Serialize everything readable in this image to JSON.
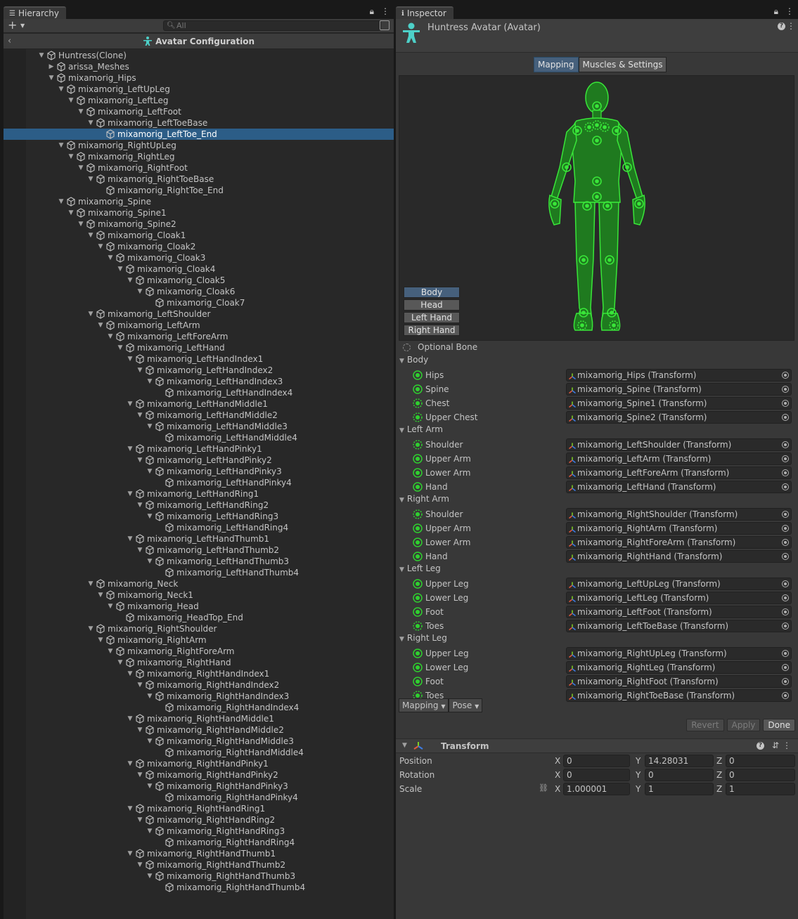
{
  "hierarchy": {
    "tab_label": "Hierarchy",
    "search_placeholder": "All",
    "header_title": "Avatar Configuration",
    "selected_row": 7,
    "rows": [
      {
        "depth": 0,
        "label": "Huntress(Clone)",
        "fold": "open"
      },
      {
        "depth": 1,
        "label": "arissa_Meshes",
        "fold": "closed"
      },
      {
        "depth": 1,
        "label": "mixamorig_Hips",
        "fold": "open"
      },
      {
        "depth": 2,
        "label": "mixamorig_LeftUpLeg",
        "fold": "open"
      },
      {
        "depth": 3,
        "label": "mixamorig_LeftLeg",
        "fold": "open"
      },
      {
        "depth": 4,
        "label": "mixamorig_LeftFoot",
        "fold": "open"
      },
      {
        "depth": 5,
        "label": "mixamorig_LeftToeBase",
        "fold": "open"
      },
      {
        "depth": 6,
        "label": "mixamorig_LeftToe_End",
        "fold": "none"
      },
      {
        "depth": 2,
        "label": "mixamorig_RightUpLeg",
        "fold": "open"
      },
      {
        "depth": 3,
        "label": "mixamorig_RightLeg",
        "fold": "open"
      },
      {
        "depth": 4,
        "label": "mixamorig_RightFoot",
        "fold": "open"
      },
      {
        "depth": 5,
        "label": "mixamorig_RightToeBase",
        "fold": "open"
      },
      {
        "depth": 6,
        "label": "mixamorig_RightToe_End",
        "fold": "none"
      },
      {
        "depth": 2,
        "label": "mixamorig_Spine",
        "fold": "open"
      },
      {
        "depth": 3,
        "label": "mixamorig_Spine1",
        "fold": "open"
      },
      {
        "depth": 4,
        "label": "mixamorig_Spine2",
        "fold": "open"
      },
      {
        "depth": 5,
        "label": "mixamorig_Cloak1",
        "fold": "open"
      },
      {
        "depth": 6,
        "label": "mixamorig_Cloak2",
        "fold": "open"
      },
      {
        "depth": 7,
        "label": "mixamorig_Cloak3",
        "fold": "open"
      },
      {
        "depth": 8,
        "label": "mixamorig_Cloak4",
        "fold": "open"
      },
      {
        "depth": 9,
        "label": "mixamorig_Cloak5",
        "fold": "open"
      },
      {
        "depth": 10,
        "label": "mixamorig_Cloak6",
        "fold": "open"
      },
      {
        "depth": 11,
        "label": "mixamorig_Cloak7",
        "fold": "none"
      },
      {
        "depth": 5,
        "label": "mixamorig_LeftShoulder",
        "fold": "open"
      },
      {
        "depth": 6,
        "label": "mixamorig_LeftArm",
        "fold": "open"
      },
      {
        "depth": 7,
        "label": "mixamorig_LeftForeArm",
        "fold": "open"
      },
      {
        "depth": 8,
        "label": "mixamorig_LeftHand",
        "fold": "open"
      },
      {
        "depth": 9,
        "label": "mixamorig_LeftHandIndex1",
        "fold": "open"
      },
      {
        "depth": 10,
        "label": "mixamorig_LeftHandIndex2",
        "fold": "open"
      },
      {
        "depth": 11,
        "label": "mixamorig_LeftHandIndex3",
        "fold": "open"
      },
      {
        "depth": 12,
        "label": "mixamorig_LeftHandIndex4",
        "fold": "none"
      },
      {
        "depth": 9,
        "label": "mixamorig_LeftHandMiddle1",
        "fold": "open"
      },
      {
        "depth": 10,
        "label": "mixamorig_LeftHandMiddle2",
        "fold": "open"
      },
      {
        "depth": 11,
        "label": "mixamorig_LeftHandMiddle3",
        "fold": "open"
      },
      {
        "depth": 12,
        "label": "mixamorig_LeftHandMiddle4",
        "fold": "none"
      },
      {
        "depth": 9,
        "label": "mixamorig_LeftHandPinky1",
        "fold": "open"
      },
      {
        "depth": 10,
        "label": "mixamorig_LeftHandPinky2",
        "fold": "open"
      },
      {
        "depth": 11,
        "label": "mixamorig_LeftHandPinky3",
        "fold": "open"
      },
      {
        "depth": 12,
        "label": "mixamorig_LeftHandPinky4",
        "fold": "none"
      },
      {
        "depth": 9,
        "label": "mixamorig_LeftHandRing1",
        "fold": "open"
      },
      {
        "depth": 10,
        "label": "mixamorig_LeftHandRing2",
        "fold": "open"
      },
      {
        "depth": 11,
        "label": "mixamorig_LeftHandRing3",
        "fold": "open"
      },
      {
        "depth": 12,
        "label": "mixamorig_LeftHandRing4",
        "fold": "none"
      },
      {
        "depth": 9,
        "label": "mixamorig_LeftHandThumb1",
        "fold": "open"
      },
      {
        "depth": 10,
        "label": "mixamorig_LeftHandThumb2",
        "fold": "open"
      },
      {
        "depth": 11,
        "label": "mixamorig_LeftHandThumb3",
        "fold": "open"
      },
      {
        "depth": 12,
        "label": "mixamorig_LeftHandThumb4",
        "fold": "none"
      },
      {
        "depth": 5,
        "label": "mixamorig_Neck",
        "fold": "open"
      },
      {
        "depth": 6,
        "label": "mixamorig_Neck1",
        "fold": "open"
      },
      {
        "depth": 7,
        "label": "mixamorig_Head",
        "fold": "open"
      },
      {
        "depth": 8,
        "label": "mixamorig_HeadTop_End",
        "fold": "none"
      },
      {
        "depth": 5,
        "label": "mixamorig_RightShoulder",
        "fold": "open"
      },
      {
        "depth": 6,
        "label": "mixamorig_RightArm",
        "fold": "open"
      },
      {
        "depth": 7,
        "label": "mixamorig_RightForeArm",
        "fold": "open"
      },
      {
        "depth": 8,
        "label": "mixamorig_RightHand",
        "fold": "open"
      },
      {
        "depth": 9,
        "label": "mixamorig_RightHandIndex1",
        "fold": "open"
      },
      {
        "depth": 10,
        "label": "mixamorig_RightHandIndex2",
        "fold": "open"
      },
      {
        "depth": 11,
        "label": "mixamorig_RightHandIndex3",
        "fold": "open"
      },
      {
        "depth": 12,
        "label": "mixamorig_RightHandIndex4",
        "fold": "none"
      },
      {
        "depth": 9,
        "label": "mixamorig_RightHandMiddle1",
        "fold": "open"
      },
      {
        "depth": 10,
        "label": "mixamorig_RightHandMiddle2",
        "fold": "open"
      },
      {
        "depth": 11,
        "label": "mixamorig_RightHandMiddle3",
        "fold": "open"
      },
      {
        "depth": 12,
        "label": "mixamorig_RightHandMiddle4",
        "fold": "none"
      },
      {
        "depth": 9,
        "label": "mixamorig_RightHandPinky1",
        "fold": "open"
      },
      {
        "depth": 10,
        "label": "mixamorig_RightHandPinky2",
        "fold": "open"
      },
      {
        "depth": 11,
        "label": "mixamorig_RightHandPinky3",
        "fold": "open"
      },
      {
        "depth": 12,
        "label": "mixamorig_RightHandPinky4",
        "fold": "none"
      },
      {
        "depth": 9,
        "label": "mixamorig_RightHandRing1",
        "fold": "open"
      },
      {
        "depth": 10,
        "label": "mixamorig_RightHandRing2",
        "fold": "open"
      },
      {
        "depth": 11,
        "label": "mixamorig_RightHandRing3",
        "fold": "open"
      },
      {
        "depth": 12,
        "label": "mixamorig_RightHandRing4",
        "fold": "none"
      },
      {
        "depth": 9,
        "label": "mixamorig_RightHandThumb1",
        "fold": "open"
      },
      {
        "depth": 10,
        "label": "mixamorig_RightHandThumb2",
        "fold": "open"
      },
      {
        "depth": 11,
        "label": "mixamorig_RightHandThumb3",
        "fold": "open"
      },
      {
        "depth": 12,
        "label": "mixamorig_RightHandThumb4",
        "fold": "none"
      }
    ]
  },
  "inspector": {
    "tab_label": "Inspector",
    "title": "Huntress Avatar (Avatar)",
    "tabs": [
      {
        "label": "Mapping",
        "active": true
      },
      {
        "label": "Muscles & Settings",
        "active": false
      }
    ],
    "regions": [
      {
        "label": "Body",
        "active": true
      },
      {
        "label": "Head",
        "active": false
      },
      {
        "label": "Left Hand",
        "active": false
      },
      {
        "label": "Right Hand",
        "active": false
      }
    ],
    "optional_bone_label": "Optional Bone",
    "groups": [
      {
        "name": "Body",
        "bones": [
          {
            "name": "Hips",
            "value": "mixamorig_Hips (Transform)",
            "optional": false
          },
          {
            "name": "Spine",
            "value": "mixamorig_Spine (Transform)",
            "optional": false
          },
          {
            "name": "Chest",
            "value": "mixamorig_Spine1 (Transform)",
            "optional": true
          },
          {
            "name": "Upper Chest",
            "value": "mixamorig_Spine2 (Transform)",
            "optional": true
          }
        ]
      },
      {
        "name": "Left Arm",
        "bones": [
          {
            "name": "Shoulder",
            "value": "mixamorig_LeftShoulder (Transform)",
            "optional": true
          },
          {
            "name": "Upper Arm",
            "value": "mixamorig_LeftArm (Transform)",
            "optional": false
          },
          {
            "name": "Lower Arm",
            "value": "mixamorig_LeftForeArm (Transform)",
            "optional": false
          },
          {
            "name": "Hand",
            "value": "mixamorig_LeftHand (Transform)",
            "optional": false
          }
        ]
      },
      {
        "name": "Right Arm",
        "bones": [
          {
            "name": "Shoulder",
            "value": "mixamorig_RightShoulder (Transform)",
            "optional": true
          },
          {
            "name": "Upper Arm",
            "value": "mixamorig_RightArm (Transform)",
            "optional": false
          },
          {
            "name": "Lower Arm",
            "value": "mixamorig_RightForeArm (Transform)",
            "optional": false
          },
          {
            "name": "Hand",
            "value": "mixamorig_RightHand (Transform)",
            "optional": false
          }
        ]
      },
      {
        "name": "Left Leg",
        "bones": [
          {
            "name": "Upper Leg",
            "value": "mixamorig_LeftUpLeg (Transform)",
            "optional": false
          },
          {
            "name": "Lower Leg",
            "value": "mixamorig_LeftLeg (Transform)",
            "optional": false
          },
          {
            "name": "Foot",
            "value": "mixamorig_LeftFoot (Transform)",
            "optional": false
          },
          {
            "name": "Toes",
            "value": "mixamorig_LeftToeBase (Transform)",
            "optional": true
          }
        ]
      },
      {
        "name": "Right Leg",
        "bones": [
          {
            "name": "Upper Leg",
            "value": "mixamorig_RightUpLeg (Transform)",
            "optional": false
          },
          {
            "name": "Lower Leg",
            "value": "mixamorig_RightLeg (Transform)",
            "optional": false
          },
          {
            "name": "Foot",
            "value": "mixamorig_RightFoot (Transform)",
            "optional": false
          },
          {
            "name": "Toes",
            "value": "mixamorig_RightToeBase (Transform)",
            "optional": true
          }
        ]
      }
    ],
    "mapping_dropdown": "Mapping",
    "pose_dropdown": "Pose",
    "revert_label": "Revert",
    "apply_label": "Apply",
    "done_label": "Done",
    "transform": {
      "title": "Transform",
      "rows": [
        {
          "label": "Position",
          "x": "0",
          "y": "14.28031",
          "z": "0"
        },
        {
          "label": "Rotation",
          "x": "0",
          "y": "0",
          "z": "0"
        },
        {
          "label": "Scale",
          "x": "1.000001",
          "y": "1",
          "z": "1"
        }
      ],
      "axis_x": "X",
      "axis_y": "Y",
      "axis_z": "Z"
    }
  },
  "colors": {
    "accent": "#2c5d87",
    "bone_green": "#2fd02f",
    "active_tab": "#46607c"
  }
}
